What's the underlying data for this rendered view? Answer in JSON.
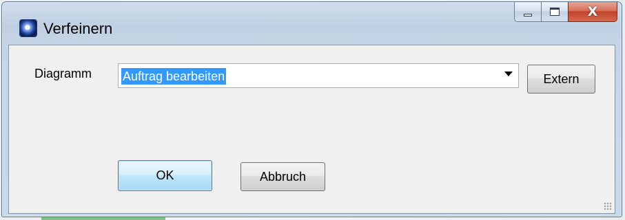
{
  "window": {
    "title": "Verfeinern",
    "close_glyph": "X"
  },
  "form": {
    "diagram_label": "Diagramm",
    "diagram_value": "Auftrag bearbeiten",
    "extern_label": "Extern",
    "ok_label": "OK",
    "cancel_label": "Abbruch"
  },
  "icons": {
    "app": "app-icon",
    "minimize": "minimize-icon",
    "maximize": "maximize-icon",
    "close": "close-icon",
    "dropdown": "chevron-down-icon",
    "resize": "resize-grip-icon"
  },
  "colors": {
    "selection": "#3399ff",
    "close_button": "#c2432a",
    "default_button_border": "#3c7fb1"
  }
}
